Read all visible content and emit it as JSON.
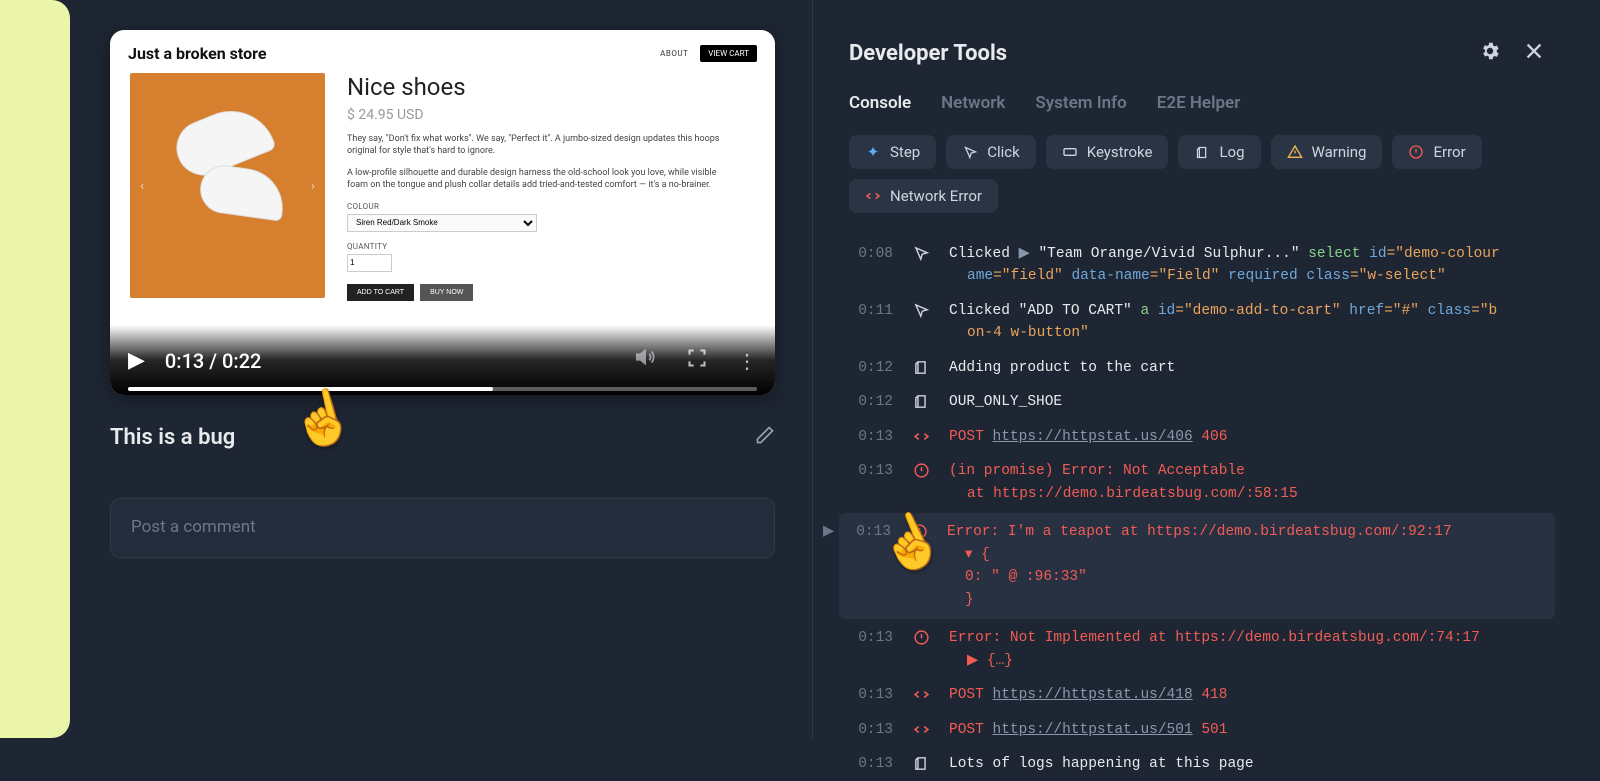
{
  "store": {
    "title": "Just a broken store",
    "about": "ABOUT",
    "view_cart": "VIEW CART",
    "product_name": "Nice shoes",
    "price": "$ 24.95 USD",
    "desc1": "They say, \"Don't fix what works\". We say, \"Perfect it\". A jumbo-sized design updates this hoops original for style that's hard to ignore.",
    "desc2": "A low-profile silhouette and durable design harness the old-school look you love, while visible foam on the tongue and plush collar details add tried-and-tested comfort — it's a no-brainer.",
    "colour_label": "COLOUR",
    "colour_value": "Siren Red/Dark Smoke",
    "qty_label": "QUANTITY",
    "qty_value": "1",
    "add_to_cart": "ADD TO CART",
    "buy_now": "BUY NOW"
  },
  "video": {
    "current": "0:13",
    "separator": " / ",
    "total": "0:22"
  },
  "bug": {
    "title": "This is a bug",
    "comment_placeholder": "Post a comment"
  },
  "devtools": {
    "title": "Developer Tools",
    "tabs": {
      "console": "Console",
      "network": "Network",
      "system": "System Info",
      "e2e": "E2E Helper"
    },
    "filters": {
      "step": "Step",
      "click": "Click",
      "keystroke": "Keystroke",
      "log": "Log",
      "warning": "Warning",
      "error": "Error",
      "network_error": "Network Error"
    },
    "logs": [
      {
        "time": "0:08",
        "icon": "cursor",
        "type": "click",
        "parts": [
          {
            "t": "Clicked ",
            "c": "white"
          },
          {
            "t": "▶ ",
            "c": "gray"
          },
          {
            "t": "\"Team Orange/Vivid Sulphur...\" ",
            "c": "white"
          },
          {
            "t": "select ",
            "c": "green"
          },
          {
            "t": "id",
            "c": "blue"
          },
          {
            "t": "=\"demo-colour",
            "c": "orange"
          }
        ],
        "cont": [
          {
            "t": "ame",
            "c": "blue"
          },
          {
            "t": "=\"field\" ",
            "c": "orange"
          },
          {
            "t": "data-name",
            "c": "blue"
          },
          {
            "t": "=\"Field\" ",
            "c": "orange"
          },
          {
            "t": "required ",
            "c": "blue"
          },
          {
            "t": "class",
            "c": "blue"
          },
          {
            "t": "=\"w-select\"",
            "c": "orange"
          }
        ]
      },
      {
        "time": "0:11",
        "icon": "cursor",
        "type": "click",
        "parts": [
          {
            "t": "Clicked ",
            "c": "white"
          },
          {
            "t": "\"ADD TO CART\" ",
            "c": "white"
          },
          {
            "t": "a ",
            "c": "green"
          },
          {
            "t": "id",
            "c": "blue"
          },
          {
            "t": "=\"demo-add-to-cart\" ",
            "c": "orange"
          },
          {
            "t": "href",
            "c": "blue"
          },
          {
            "t": "=\"#\" ",
            "c": "orange"
          },
          {
            "t": "class",
            "c": "blue"
          },
          {
            "t": "=\"b",
            "c": "orange"
          }
        ],
        "cont": [
          {
            "t": "on-4 w-button\"",
            "c": "orange"
          }
        ]
      },
      {
        "time": "0:12",
        "icon": "log",
        "type": "log",
        "parts": [
          {
            "t": "Adding product to the cart",
            "c": "white"
          }
        ]
      },
      {
        "time": "0:12",
        "icon": "log",
        "type": "log",
        "parts": [
          {
            "t": "OUR_ONLY_SHOE",
            "c": "white"
          }
        ]
      },
      {
        "time": "0:13",
        "icon": "net",
        "type": "net",
        "parts": [
          {
            "t": "POST ",
            "c": "red"
          },
          {
            "t": "https://httpstat.us/406",
            "c": "gray",
            "u": true
          },
          {
            "t": " 406",
            "c": "red"
          }
        ]
      },
      {
        "time": "0:13",
        "icon": "error",
        "type": "error",
        "parts": [
          {
            "t": "(in promise) Error: Not Acceptable",
            "c": "red"
          }
        ],
        "cont": [
          {
            "t": "   at https://demo.birdeatsbug.com/:58:15",
            "c": "red"
          }
        ]
      },
      {
        "time": "0:13",
        "icon": "error",
        "type": "error",
        "highlighted": true,
        "expand": true,
        "parts": [
          {
            "t": "Error: I'm a teapot at https://demo.birdeatsbug.com/:92:17",
            "c": "red"
          }
        ],
        "cont": [
          {
            "t": "▾ {",
            "c": "red"
          },
          {
            "br": true
          },
          {
            "t": "    0: \"   @ :96:33\"",
            "c": "red"
          },
          {
            "br": true
          },
          {
            "t": "}",
            "c": "red"
          }
        ]
      },
      {
        "time": "0:13",
        "icon": "error",
        "type": "error",
        "parts": [
          {
            "t": "Error: Not Implemented at https://demo.birdeatsbug.com/:74:17",
            "c": "red"
          }
        ],
        "cont": [
          {
            "t": "▶  {…}",
            "c": "red"
          }
        ]
      },
      {
        "time": "0:13",
        "icon": "net",
        "type": "net",
        "parts": [
          {
            "t": "POST ",
            "c": "red"
          },
          {
            "t": "https://httpstat.us/418",
            "c": "gray",
            "u": true
          },
          {
            "t": " 418",
            "c": "red"
          }
        ]
      },
      {
        "time": "0:13",
        "icon": "net",
        "type": "net",
        "parts": [
          {
            "t": "POST ",
            "c": "red"
          },
          {
            "t": "https://httpstat.us/501",
            "c": "gray",
            "u": true
          },
          {
            "t": " 501",
            "c": "red"
          }
        ]
      },
      {
        "time": "0:13",
        "icon": "log",
        "type": "log",
        "parts": [
          {
            "t": "Lots of logs happening at this page",
            "c": "white"
          }
        ]
      }
    ]
  }
}
